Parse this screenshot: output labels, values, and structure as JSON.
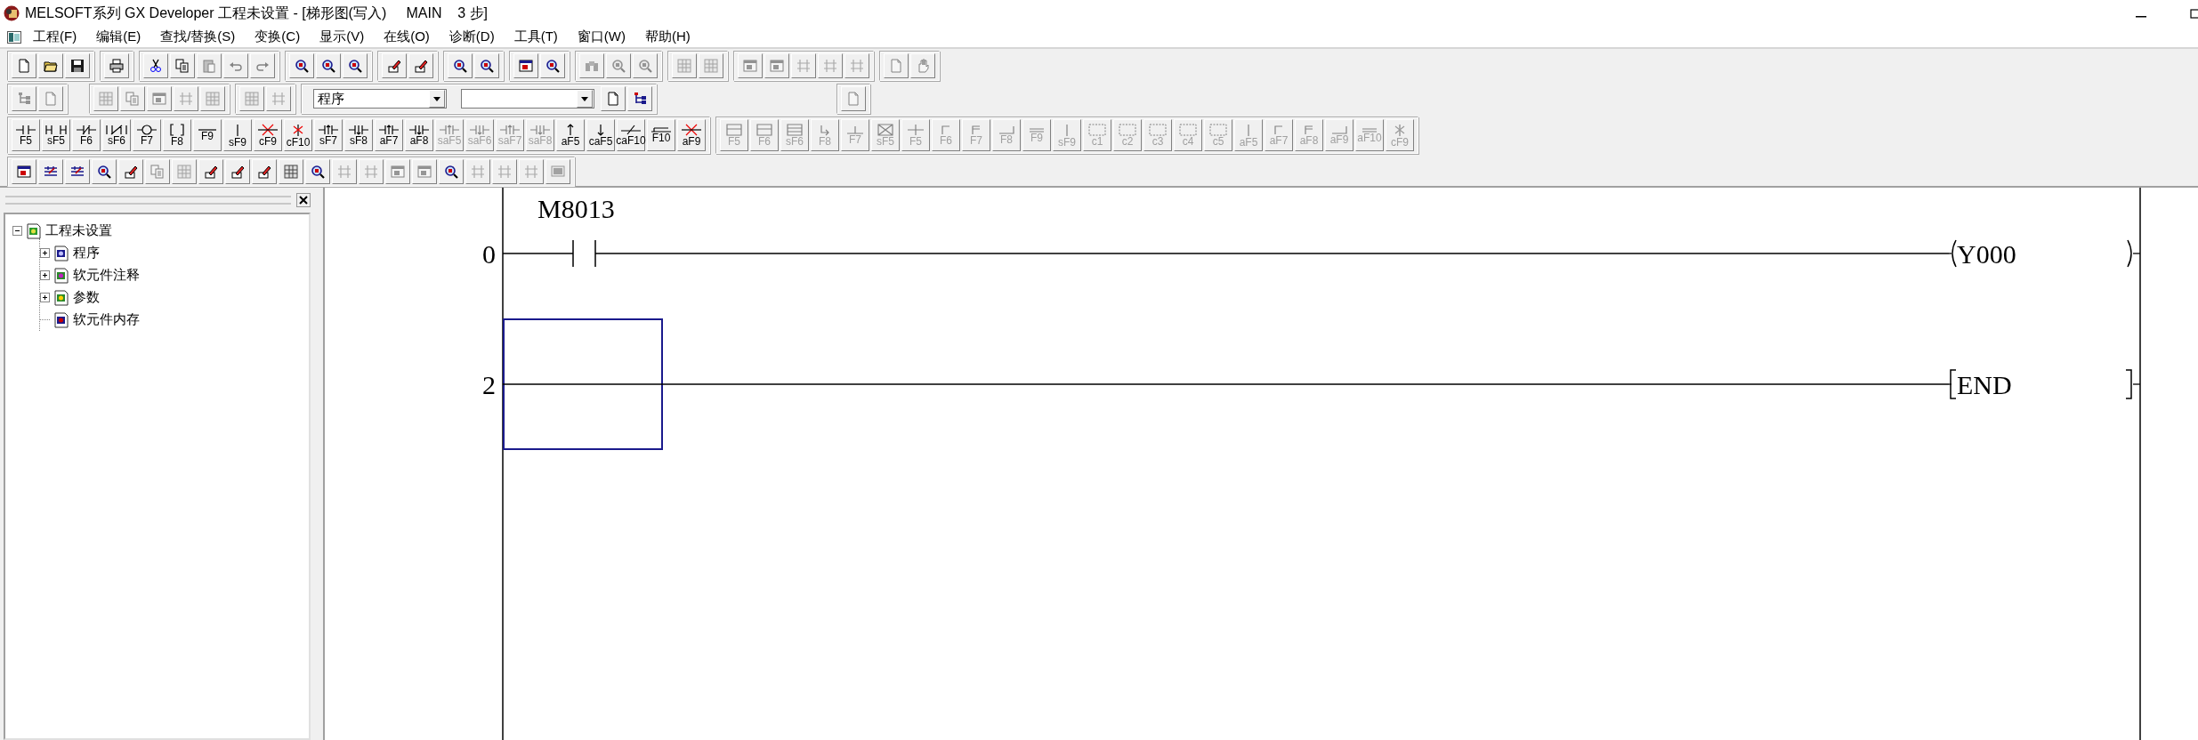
{
  "window": {
    "title": "MELSOFT系列 GX Developer 工程未设置 - [梯形图(写入)     MAIN    3 步]"
  },
  "menu": [
    {
      "label": "工程(F)"
    },
    {
      "label": "编辑(E)"
    },
    {
      "label": "查找/替换(S)"
    },
    {
      "label": "变换(C)"
    },
    {
      "label": "显示(V)"
    },
    {
      "label": "在线(O)"
    },
    {
      "label": "诊断(D)"
    },
    {
      "label": "工具(T)"
    },
    {
      "label": "窗口(W)"
    },
    {
      "label": "帮助(H)"
    }
  ],
  "toolbars": [
    {
      "groups": [
        {
          "buttons": [
            {
              "kind": "icon",
              "disabled": false
            },
            {
              "kind": "icon",
              "disabled": false
            },
            {
              "kind": "icon",
              "disabled": false
            }
          ]
        },
        {
          "buttons": [
            {
              "kind": "icon",
              "disabled": false
            }
          ]
        },
        {
          "buttons": [
            {
              "kind": "icon",
              "disabled": false
            },
            {
              "kind": "icon",
              "disabled": false
            },
            {
              "kind": "icon",
              "disabled": true
            },
            {
              "kind": "icon",
              "disabled": true
            },
            {
              "kind": "icon",
              "disabled": true
            }
          ]
        },
        {
          "buttons": [
            {
              "kind": "icon",
              "disabled": false
            },
            {
              "kind": "icon",
              "disabled": false
            },
            {
              "kind": "icon",
              "disabled": false
            }
          ]
        },
        {
          "buttons": [
            {
              "kind": "icon",
              "disabled": false
            },
            {
              "kind": "icon",
              "disabled": false
            }
          ]
        },
        {
          "buttons": [
            {
              "kind": "icon",
              "disabled": false
            },
            {
              "kind": "icon",
              "disabled": false
            }
          ]
        },
        {
          "buttons": [
            {
              "kind": "icon",
              "disabled": false
            },
            {
              "kind": "icon",
              "disabled": false
            }
          ]
        },
        {
          "buttons": [
            {
              "kind": "icon",
              "disabled": true
            },
            {
              "kind": "icon",
              "disabled": true
            },
            {
              "kind": "icon",
              "disabled": true
            }
          ]
        },
        {
          "buttons": [
            {
              "kind": "icon",
              "disabled": true
            },
            {
              "kind": "icon",
              "disabled": true
            }
          ]
        },
        {
          "buttons": [
            {
              "kind": "icon",
              "disabled": true
            },
            {
              "kind": "icon",
              "disabled": true
            },
            {
              "kind": "icon",
              "disabled": true
            },
            {
              "kind": "icon",
              "disabled": true
            },
            {
              "kind": "icon",
              "disabled": true
            }
          ]
        },
        {
          "buttons": [
            {
              "kind": "icon",
              "disabled": true
            },
            {
              "kind": "icon",
              "disabled": true
            }
          ]
        }
      ]
    },
    {
      "groups": [
        {
          "buttons": [
            {
              "kind": "icon",
              "disabled": true
            },
            {
              "kind": "icon",
              "disabled": true
            }
          ]
        },
        {
          "buttons": [
            {
              "kind": "icon",
              "disabled": true
            },
            {
              "kind": "icon",
              "disabled": true
            },
            {
              "kind": "icon",
              "disabled": true
            },
            {
              "kind": "icon",
              "disabled": true
            },
            {
              "kind": "icon",
              "disabled": true
            }
          ]
        },
        {
          "buttons": [
            {
              "kind": "icon",
              "disabled": true
            },
            {
              "kind": "icon",
              "disabled": true
            }
          ]
        },
        {
          "buttons": [
            {
              "kind": "combo",
              "value": "程序"
            },
            {
              "kind": "combo"
            },
            {
              "kind": "icon",
              "disabled": false
            },
            {
              "kind": "icon",
              "disabled": false
            }
          ]
        },
        {
          "buttons": [
            {
              "kind": "icon",
              "disabled": true
            }
          ]
        }
      ]
    },
    {
      "groups": [
        {
          "buttons": [
            {
              "kind": "key",
              "label": "F5",
              "disabled": false
            },
            {
              "kind": "key",
              "label": "sF5",
              "disabled": false
            },
            {
              "kind": "key",
              "label": "F6",
              "disabled": false
            },
            {
              "kind": "key",
              "label": "sF6",
              "disabled": false
            },
            {
              "kind": "key",
              "label": "F7",
              "disabled": false
            },
            {
              "kind": "key",
              "label": "F8",
              "disabled": false
            },
            {
              "kind": "key",
              "label": "F9",
              "disabled": false
            },
            {
              "kind": "key",
              "label": "sF9",
              "disabled": false
            },
            {
              "kind": "key",
              "label": "cF9",
              "disabled": false
            },
            {
              "kind": "key",
              "label": "cF10",
              "disabled": false
            },
            {
              "kind": "key",
              "label": "sF7",
              "disabled": false
            },
            {
              "kind": "key",
              "label": "sF8",
              "disabled": false
            },
            {
              "kind": "key",
              "label": "aF7",
              "disabled": false
            },
            {
              "kind": "key",
              "label": "aF8",
              "disabled": false
            },
            {
              "kind": "key",
              "label": "saF5",
              "disabled": true
            },
            {
              "kind": "key",
              "label": "saF6",
              "disabled": true
            },
            {
              "kind": "key",
              "label": "saF7",
              "disabled": true
            },
            {
              "kind": "key",
              "label": "saF8",
              "disabled": true
            },
            {
              "kind": "key",
              "label": "aF5",
              "disabled": false
            },
            {
              "kind": "key",
              "label": "caF5",
              "disabled": false
            },
            {
              "kind": "key",
              "label": "caF10",
              "disabled": false
            },
            {
              "kind": "key",
              "label": "F10",
              "disabled": false
            },
            {
              "kind": "key",
              "label": "aF9",
              "disabled": false
            }
          ]
        },
        {
          "buttons": [
            {
              "kind": "key",
              "label": "F5",
              "disabled": true
            },
            {
              "kind": "key",
              "label": "F6",
              "disabled": true
            },
            {
              "kind": "key",
              "label": "sF6",
              "disabled": true
            },
            {
              "kind": "key",
              "label": "F8",
              "disabled": true
            },
            {
              "kind": "key",
              "label": "F7",
              "disabled": true
            },
            {
              "kind": "key",
              "label": "sF5",
              "disabled": true
            },
            {
              "kind": "key",
              "label": "F5",
              "disabled": true
            },
            {
              "kind": "key",
              "label": "F6",
              "disabled": true
            },
            {
              "kind": "key",
              "label": "F7",
              "disabled": true
            },
            {
              "kind": "key",
              "label": "F8",
              "disabled": true
            },
            {
              "kind": "key",
              "label": "F9",
              "disabled": true
            },
            {
              "kind": "key",
              "label": "sF9",
              "disabled": true
            },
            {
              "kind": "key",
              "label": "c1",
              "disabled": true
            },
            {
              "kind": "key",
              "label": "c2",
              "disabled": true
            },
            {
              "kind": "key",
              "label": "c3",
              "disabled": true
            },
            {
              "kind": "key",
              "label": "c4",
              "disabled": true
            },
            {
              "kind": "key",
              "label": "c5",
              "disabled": true
            },
            {
              "kind": "key",
              "label": "aF5",
              "disabled": true
            },
            {
              "kind": "key",
              "label": "aF7",
              "disabled": true
            },
            {
              "kind": "key",
              "label": "aF8",
              "disabled": true
            },
            {
              "kind": "key",
              "label": "aF9",
              "disabled": true
            },
            {
              "kind": "key",
              "label": "aF10",
              "disabled": true
            },
            {
              "kind": "key",
              "label": "cF9",
              "disabled": true
            }
          ]
        }
      ]
    },
    {
      "groups": [
        {
          "buttons": [
            {
              "kind": "icon",
              "disabled": false
            },
            {
              "kind": "icon",
              "disabled": false
            },
            {
              "kind": "icon",
              "disabled": false
            },
            {
              "kind": "icon",
              "disabled": false
            },
            {
              "kind": "icon",
              "disabled": false
            },
            {
              "kind": "icon",
              "disabled": true
            },
            {
              "kind": "icon",
              "disabled": true
            },
            {
              "kind": "icon",
              "disabled": false
            },
            {
              "kind": "icon",
              "disabled": false
            },
            {
              "kind": "icon",
              "disabled": false
            },
            {
              "kind": "icon",
              "disabled": false
            },
            {
              "kind": "icon",
              "disabled": false
            },
            {
              "kind": "icon",
              "disabled": true
            },
            {
              "kind": "icon",
              "disabled": true
            },
            {
              "kind": "icon",
              "disabled": true
            },
            {
              "kind": "icon",
              "disabled": true
            },
            {
              "kind": "icon",
              "disabled": false
            },
            {
              "kind": "icon",
              "disabled": true
            },
            {
              "kind": "icon",
              "disabled": true
            },
            {
              "kind": "icon",
              "disabled": true
            },
            {
              "kind": "icon",
              "disabled": true
            }
          ]
        }
      ]
    }
  ],
  "project_tree": [
    {
      "label": "工程未设置",
      "expanded": true,
      "children": [
        {
          "label": "程序",
          "expanded": false
        },
        {
          "label": "软元件注释",
          "expanded": false
        },
        {
          "label": "参数",
          "expanded": false
        },
        {
          "label": "软元件内存"
        }
      ]
    }
  ],
  "ladder": {
    "rungs": [
      {
        "step": "0",
        "cursor": false,
        "contacts": [
          {
            "kind": "no_contact",
            "device": "M8013"
          }
        ],
        "output": {
          "kind": "coil",
          "device": "Y000"
        }
      },
      {
        "step": "2",
        "cursor": true,
        "output": {
          "kind": "instruction",
          "device": "END"
        }
      }
    ]
  }
}
